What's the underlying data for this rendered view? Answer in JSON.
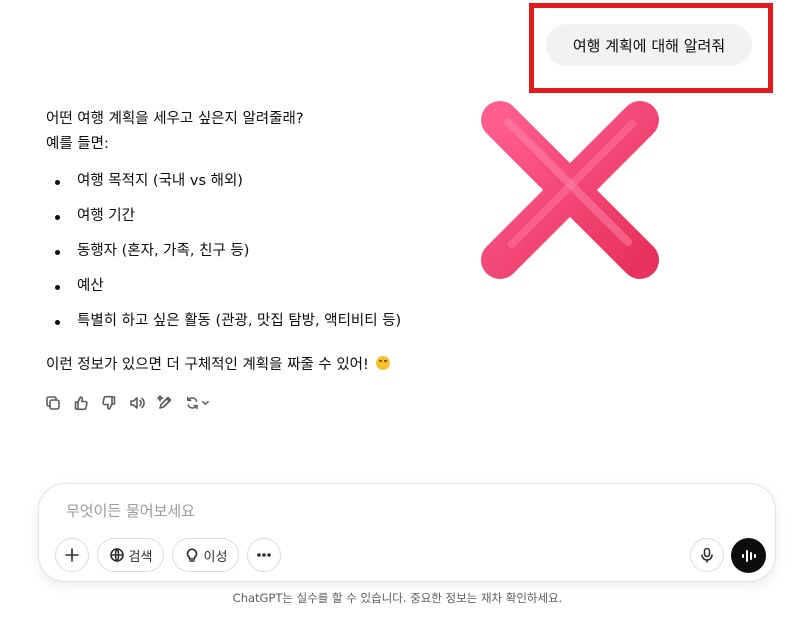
{
  "user_message": "여행 계획에 대해 알려줘",
  "assistant": {
    "intro_line1": "어떤 여행 계획을 세우고 싶은지 알려줄래?",
    "intro_line2": "예를 들면:",
    "bullets": [
      "여행 목적지 (국내 vs 해외)",
      "여행 기간",
      "동행자 (혼자, 가족, 친구 등)",
      "예산",
      "특별히 하고 싶은 활동 (관광, 맛집 탐방, 액티비티 등)"
    ],
    "closing": "이런 정보가 있으면 더 구체적인 계획을 짜줄 수 있어!",
    "emoji": "smiling-face-emoji"
  },
  "actions": [
    "copy-icon",
    "thumbs-up-icon",
    "thumbs-down-icon",
    "read-aloud-icon",
    "edit-canvas-icon",
    "regenerate-icon"
  ],
  "composer": {
    "placeholder": "무엇이든 물어보세요",
    "search_label": "검색",
    "reason_label": "이성"
  },
  "disclaimer": "ChatGPT는 실수를 할 수 있습니다. 중요한 정보는 재차 확인하세요.",
  "colors": {
    "highlight": "#e11c1c",
    "x_mark": "#f0467a",
    "bubble": "#f2f2f2"
  }
}
